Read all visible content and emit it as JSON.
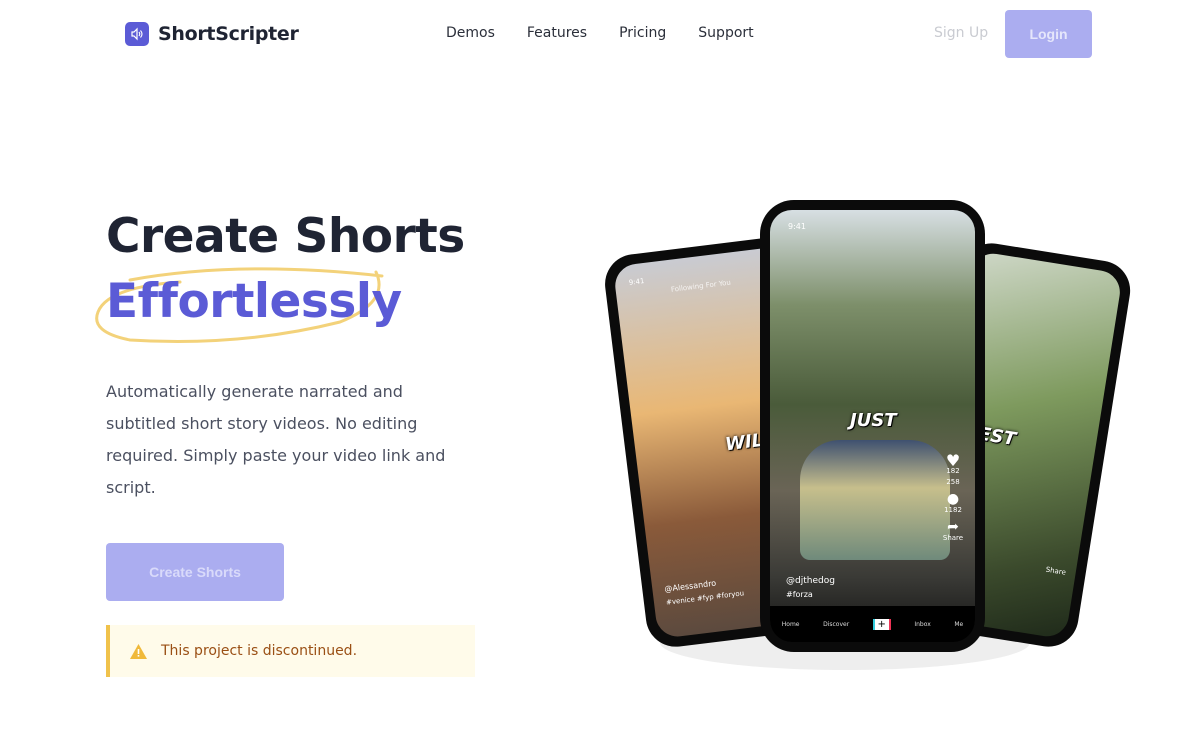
{
  "nav": {
    "brand": "ShortScripter",
    "links": [
      "Demos",
      "Features",
      "Pricing",
      "Support"
    ],
    "signup": "Sign Up",
    "login": "Login"
  },
  "hero": {
    "title_line1": "Create Shorts",
    "title_line2": "Effortlessly",
    "description": "Automatically generate narrated and subtitled short story videos. No editing required. Simply paste your video link and script.",
    "cta": "Create Shorts",
    "notice": "This project is discontinued."
  },
  "colors": {
    "accent": "#5b5bd6",
    "button_disabled": "#abadf0",
    "highlight": "#f3d27a",
    "notice_bg": "#fffbea",
    "notice_border": "#f0c24b",
    "notice_text": "#9a4f14"
  },
  "phones": {
    "center": {
      "time": "9:41",
      "caption": "JUST",
      "user": "@djthedog",
      "tags": "#forza",
      "likes": "182 258",
      "comments": "1182",
      "share": "Share",
      "nav": [
        "Home",
        "Discover",
        "+",
        "Inbox",
        "Me"
      ]
    },
    "left": {
      "time": "9:41",
      "tabs": "Following  For You",
      "caption": "WILL",
      "user": "@Alessandro",
      "tags": "#venice #fyp #foryou"
    },
    "right": {
      "caption": "TEST",
      "share": "Share"
    }
  }
}
